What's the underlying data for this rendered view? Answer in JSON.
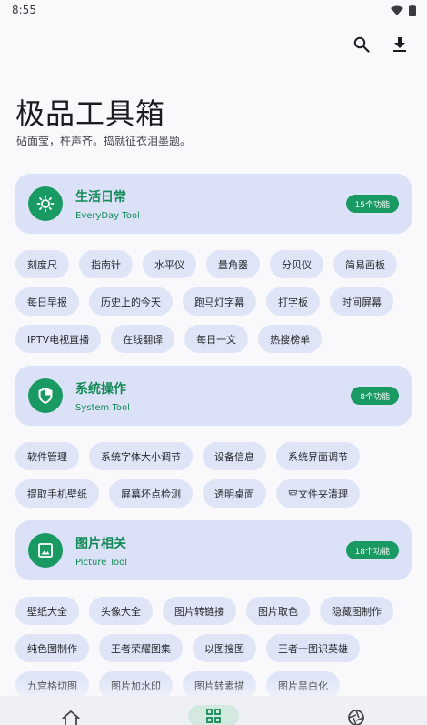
{
  "status": {
    "time": "8:55"
  },
  "header": {
    "title": "极品工具箱",
    "subtitle": "砧面莹，杵声齐。捣就征衣泪墨题。"
  },
  "sections": [
    {
      "title": "生活日常",
      "subtitle": "EveryDay Tool",
      "count": "15个功能",
      "icon": "brightness-icon",
      "tools": [
        "刻度尺",
        "指南针",
        "水平仪",
        "量角器",
        "分贝仪",
        "简易画板",
        "每日早报",
        "历史上的今天",
        "跑马灯字幕",
        "打字板",
        "时间屏幕",
        "IPTV电视直播",
        "在线翻译",
        "每日一文",
        "热搜榜单"
      ]
    },
    {
      "title": "系统操作",
      "subtitle": "System Tool",
      "count": "8个功能",
      "icon": "shield-icon",
      "tools": [
        "软件管理",
        "系统字体大小调节",
        "设备信息",
        "系统界面调节",
        "提取手机壁纸",
        "屏幕坏点检测",
        "透明桌面",
        "空文件夹清理"
      ]
    },
    {
      "title": "图片相关",
      "subtitle": "Picture Tool",
      "count": "18个功能",
      "icon": "image-icon",
      "tools": [
        "壁纸大全",
        "头像大全",
        "图片转链接",
        "图片取色",
        "隐藏图制作",
        "纯色图制作",
        "王者荣耀图集",
        "以图搜图",
        "王者一图识英雄",
        "九宫格切图",
        "图片加水印",
        "图片转素描",
        "图片黑白化"
      ]
    }
  ],
  "colors": {
    "accent": "#1a9a63",
    "card": "#dbe2f7",
    "chip": "#dfe5f7"
  }
}
